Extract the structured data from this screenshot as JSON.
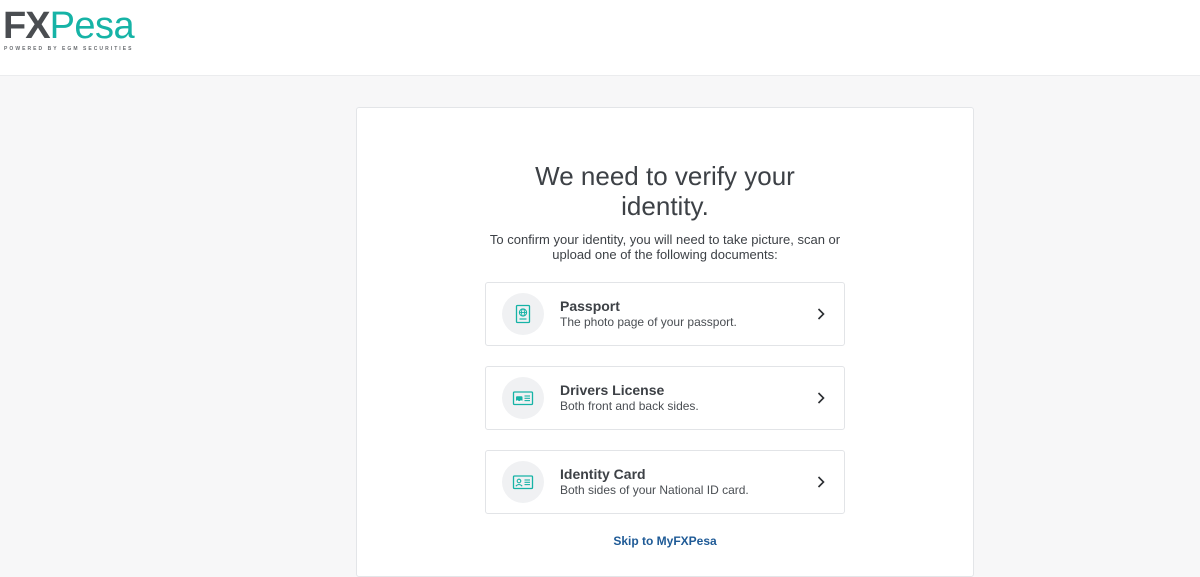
{
  "header": {
    "logo": {
      "fx": "FX",
      "pesa": "Pesa",
      "tagline": "POWERED BY EGM SECURITIES"
    }
  },
  "card": {
    "title": "We need to verify your identity.",
    "subtitle": "To confirm your identity, you will need to take picture, scan or upload one of the following documents:",
    "options": [
      {
        "title": "Passport",
        "description": "The photo page of your passport.",
        "icon": "passport-icon"
      },
      {
        "title": "Drivers License",
        "description": "Both front and back sides.",
        "icon": "drivers-license-icon"
      },
      {
        "title": "Identity Card",
        "description": "Both sides of your National ID card.",
        "icon": "identity-card-icon"
      }
    ],
    "skip_label": "Skip to MyFXPesa"
  },
  "colors": {
    "brand_teal": "#16b3a6",
    "brand_gray": "#4a4d51",
    "link_blue": "#1e5a96"
  }
}
